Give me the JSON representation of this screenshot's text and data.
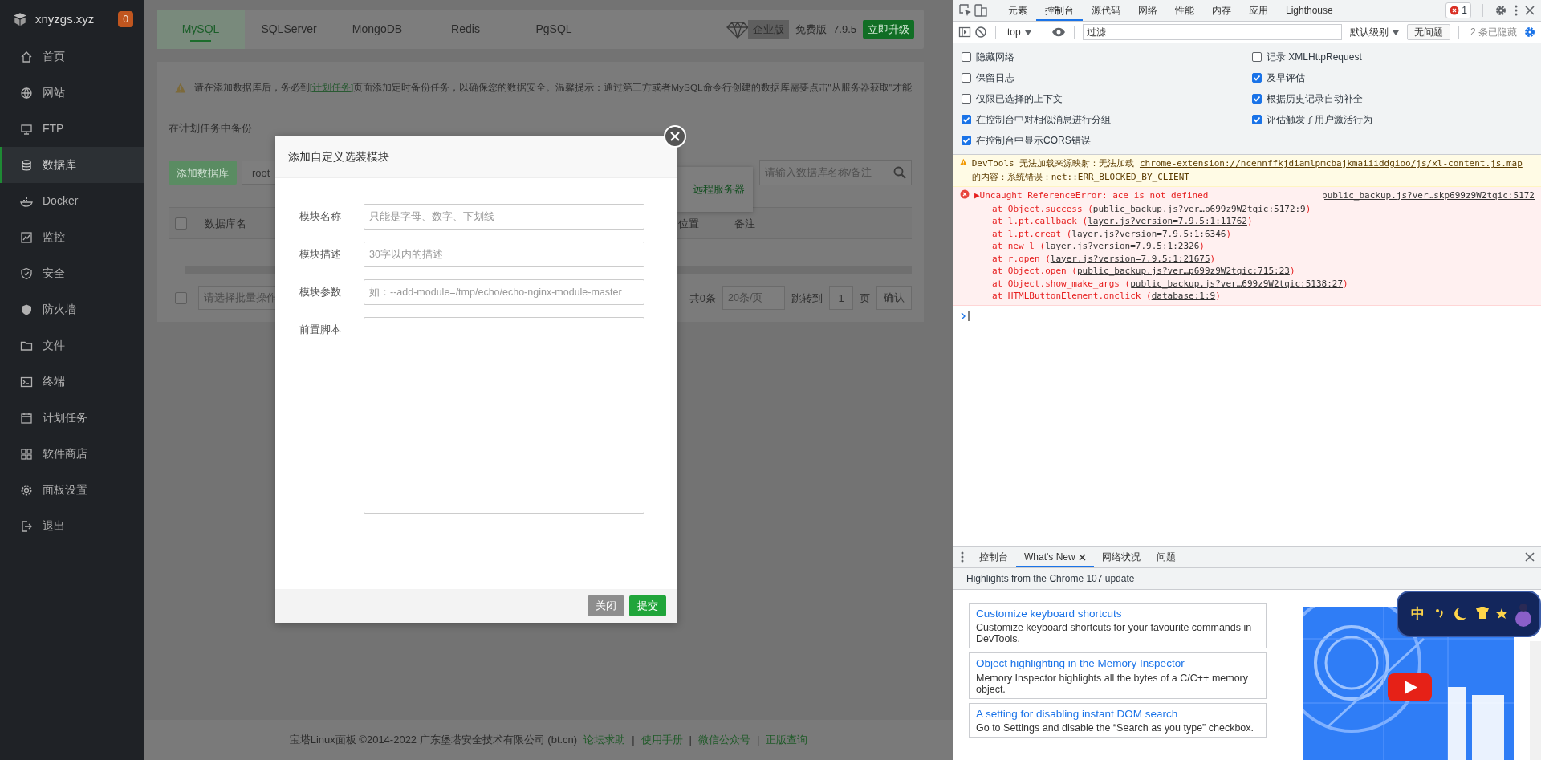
{
  "sidebar": {
    "site": "xnyzgs.xyz",
    "badge": "0",
    "items": [
      {
        "label": "首页",
        "selected": false
      },
      {
        "label": "网站",
        "selected": false
      },
      {
        "label": "FTP",
        "selected": false
      },
      {
        "label": "数据库",
        "selected": true
      },
      {
        "label": "Docker",
        "selected": false
      },
      {
        "label": "监控",
        "selected": false
      },
      {
        "label": "安全",
        "selected": false
      },
      {
        "label": "防火墙",
        "selected": false
      },
      {
        "label": "文件",
        "selected": false
      },
      {
        "label": "终端",
        "selected": false
      },
      {
        "label": "计划任务",
        "selected": false
      },
      {
        "label": "软件商店",
        "selected": false
      },
      {
        "label": "面板设置",
        "selected": false
      },
      {
        "label": "退出",
        "selected": false
      }
    ]
  },
  "db_tabs": [
    {
      "label": "MySQL",
      "selected": true
    },
    {
      "label": "SQLServer",
      "selected": false
    },
    {
      "label": "MongoDB",
      "selected": false
    },
    {
      "label": "Redis",
      "selected": false
    },
    {
      "label": "PgSQL",
      "selected": false
    }
  ],
  "edition": {
    "enterprise": "企业版",
    "free": "免费版",
    "version": "7.9.5",
    "upgrade": "立即升级"
  },
  "notice": {
    "before": "请在添加数据库后，务必到",
    "link": "[计划任务]",
    "after": "页面添加定时备份任务，以确保您的数据安全。温馨提示：通过第三方或者MySQL命令行创建的数据库需要点击\"从服务器获取\"才能"
  },
  "backup_label": "在计划任务中备份",
  "toolbar": {
    "add": "添加数据库",
    "root": "root",
    "remote": "远程服务器",
    "search_placeholder": "请输入数据库名称/备注"
  },
  "table": {
    "select_all": {
      "checked": false
    },
    "columns": [
      "数据库名",
      "位置",
      "备注"
    ]
  },
  "pager": {
    "select": {
      "checked": false
    },
    "batch": "请选择批量操作",
    "total": "共0条",
    "per_page": "20条/页",
    "jump": "跳转到",
    "page": "1",
    "page_unit": "页",
    "confirm": "确认"
  },
  "footer": {
    "text": "宝塔Linux面板 ©2014-2022 广东堡塔安全技术有限公司 (bt.cn)",
    "links": [
      {
        "label": "论坛求助",
        "sep": "|"
      },
      {
        "label": "使用手册",
        "sep": "|"
      },
      {
        "label": "微信公众号",
        "sep": "|"
      },
      {
        "label": "正版查询"
      }
    ]
  },
  "dialog": {
    "title": "添加自定义选装模块",
    "fields": [
      {
        "kind": "input",
        "label": "模块名称",
        "placeholder": "只能是字母、数字、下划线"
      },
      {
        "kind": "input",
        "label": "模块描述",
        "placeholder": "30字以内的描述"
      },
      {
        "kind": "input",
        "label": "模块参数",
        "placeholder": "如：--add-module=/tmp/echo/echo-nginx-module-master"
      },
      {
        "kind": "textarea",
        "label": "前置脚本"
      }
    ],
    "buttons": [
      {
        "kind": "secondary",
        "label": "关闭"
      },
      {
        "kind": "primary",
        "label": "提交"
      }
    ]
  },
  "devtools": {
    "tabs": [
      {
        "label": "元素",
        "selected": false
      },
      {
        "label": "控制台",
        "selected": true
      },
      {
        "label": "源代码",
        "selected": false
      },
      {
        "label": "网络",
        "selected": false
      },
      {
        "label": "性能",
        "selected": false
      },
      {
        "label": "内存",
        "selected": false
      },
      {
        "label": "应用",
        "selected": false
      },
      {
        "label": "Lighthouse",
        "selected": false
      }
    ],
    "error_count": "1",
    "context": "top",
    "filter_placeholder": "过滤",
    "level": "默认级别",
    "issues": "无问题",
    "hidden": "2 条已隐藏",
    "settings": [
      {
        "label": "隐藏网络",
        "checked": false
      },
      {
        "label": "记录 XMLHttpRequest",
        "checked": false
      },
      {
        "label": "保留日志",
        "checked": false
      },
      {
        "label": "及早评估",
        "checked": true
      },
      {
        "label": "仅限已选择的上下文",
        "checked": false
      },
      {
        "label": "根据历史记录自动补全",
        "checked": true
      },
      {
        "label": "在控制台中对相似消息进行分组",
        "checked": true
      },
      {
        "label": "评估触发了用户激活行为",
        "checked": true
      },
      {
        "label": "在控制台中显示CORS错误",
        "checked": true
      }
    ],
    "messages": [
      {
        "kind": "warning",
        "before": "DevTools 无法加载来源映射：无法加载 ",
        "link": "chrome-extension://ncennffkjdiamlpmcbajkmaiiiddgioo/js/xl-content.js.map",
        "after": " 的内容：系统错误：net::ERR_BLOCKED_BY_CLIENT"
      },
      {
        "kind": "error",
        "toggle": "▶",
        "text": "Uncaught ReferenceError: ace is not defined",
        "source": "public_backup.js?ver…skp699z9W2tqic:5172",
        "stack": [
          {
            "before": "at Object.success (",
            "link": "public_backup.js?ver…p699z9W2tqic:5172:9",
            "after": ")"
          },
          {
            "before": "at l.pt.callback (",
            "link": "layer.js?version=7.9.5:1:11762",
            "after": ")"
          },
          {
            "before": "at l.pt.creat (",
            "link": "layer.js?version=7.9.5:1:6346",
            "after": ")"
          },
          {
            "before": "at new l (",
            "link": "layer.js?version=7.9.5:1:2326",
            "after": ")"
          },
          {
            "before": "at r.open (",
            "link": "layer.js?version=7.9.5:1:21675",
            "after": ")"
          },
          {
            "before": "at Object.open (",
            "link": "public_backup.js?ver…p699z9W2tqic:715:23",
            "after": ")"
          },
          {
            "before": "at Object.show_make_args (",
            "link": "public_backup.js?ver…699z9W2tqic:5138:27",
            "after": ")"
          },
          {
            "before": "at HTMLButtonElement.onclick (",
            "link": "database:1:9",
            "after": ")"
          }
        ]
      }
    ],
    "drawer": {
      "tabs": [
        {
          "label": "控制台",
          "selected": false,
          "closable": false
        },
        {
          "label": "What's New",
          "selected": true,
          "closable": true
        },
        {
          "label": "网络状况",
          "selected": false,
          "closable": false
        },
        {
          "label": "问题",
          "selected": false,
          "closable": false
        }
      ],
      "headline": "Highlights from the Chrome 107 update",
      "cards": [
        {
          "title": "Customize keyboard shortcuts",
          "desc": "Customize keyboard shortcuts for your favourite commands in DevTools."
        },
        {
          "title": "Object highlighting in the Memory Inspector",
          "desc": "Memory Inspector highlights all the bytes of a C/C++ memory object."
        },
        {
          "title": "A setting for disabling instant DOM search",
          "desc": "Go to Settings and disable the “Search as you type” checkbox."
        }
      ]
    },
    "ime": {
      "mode": "中"
    }
  }
}
